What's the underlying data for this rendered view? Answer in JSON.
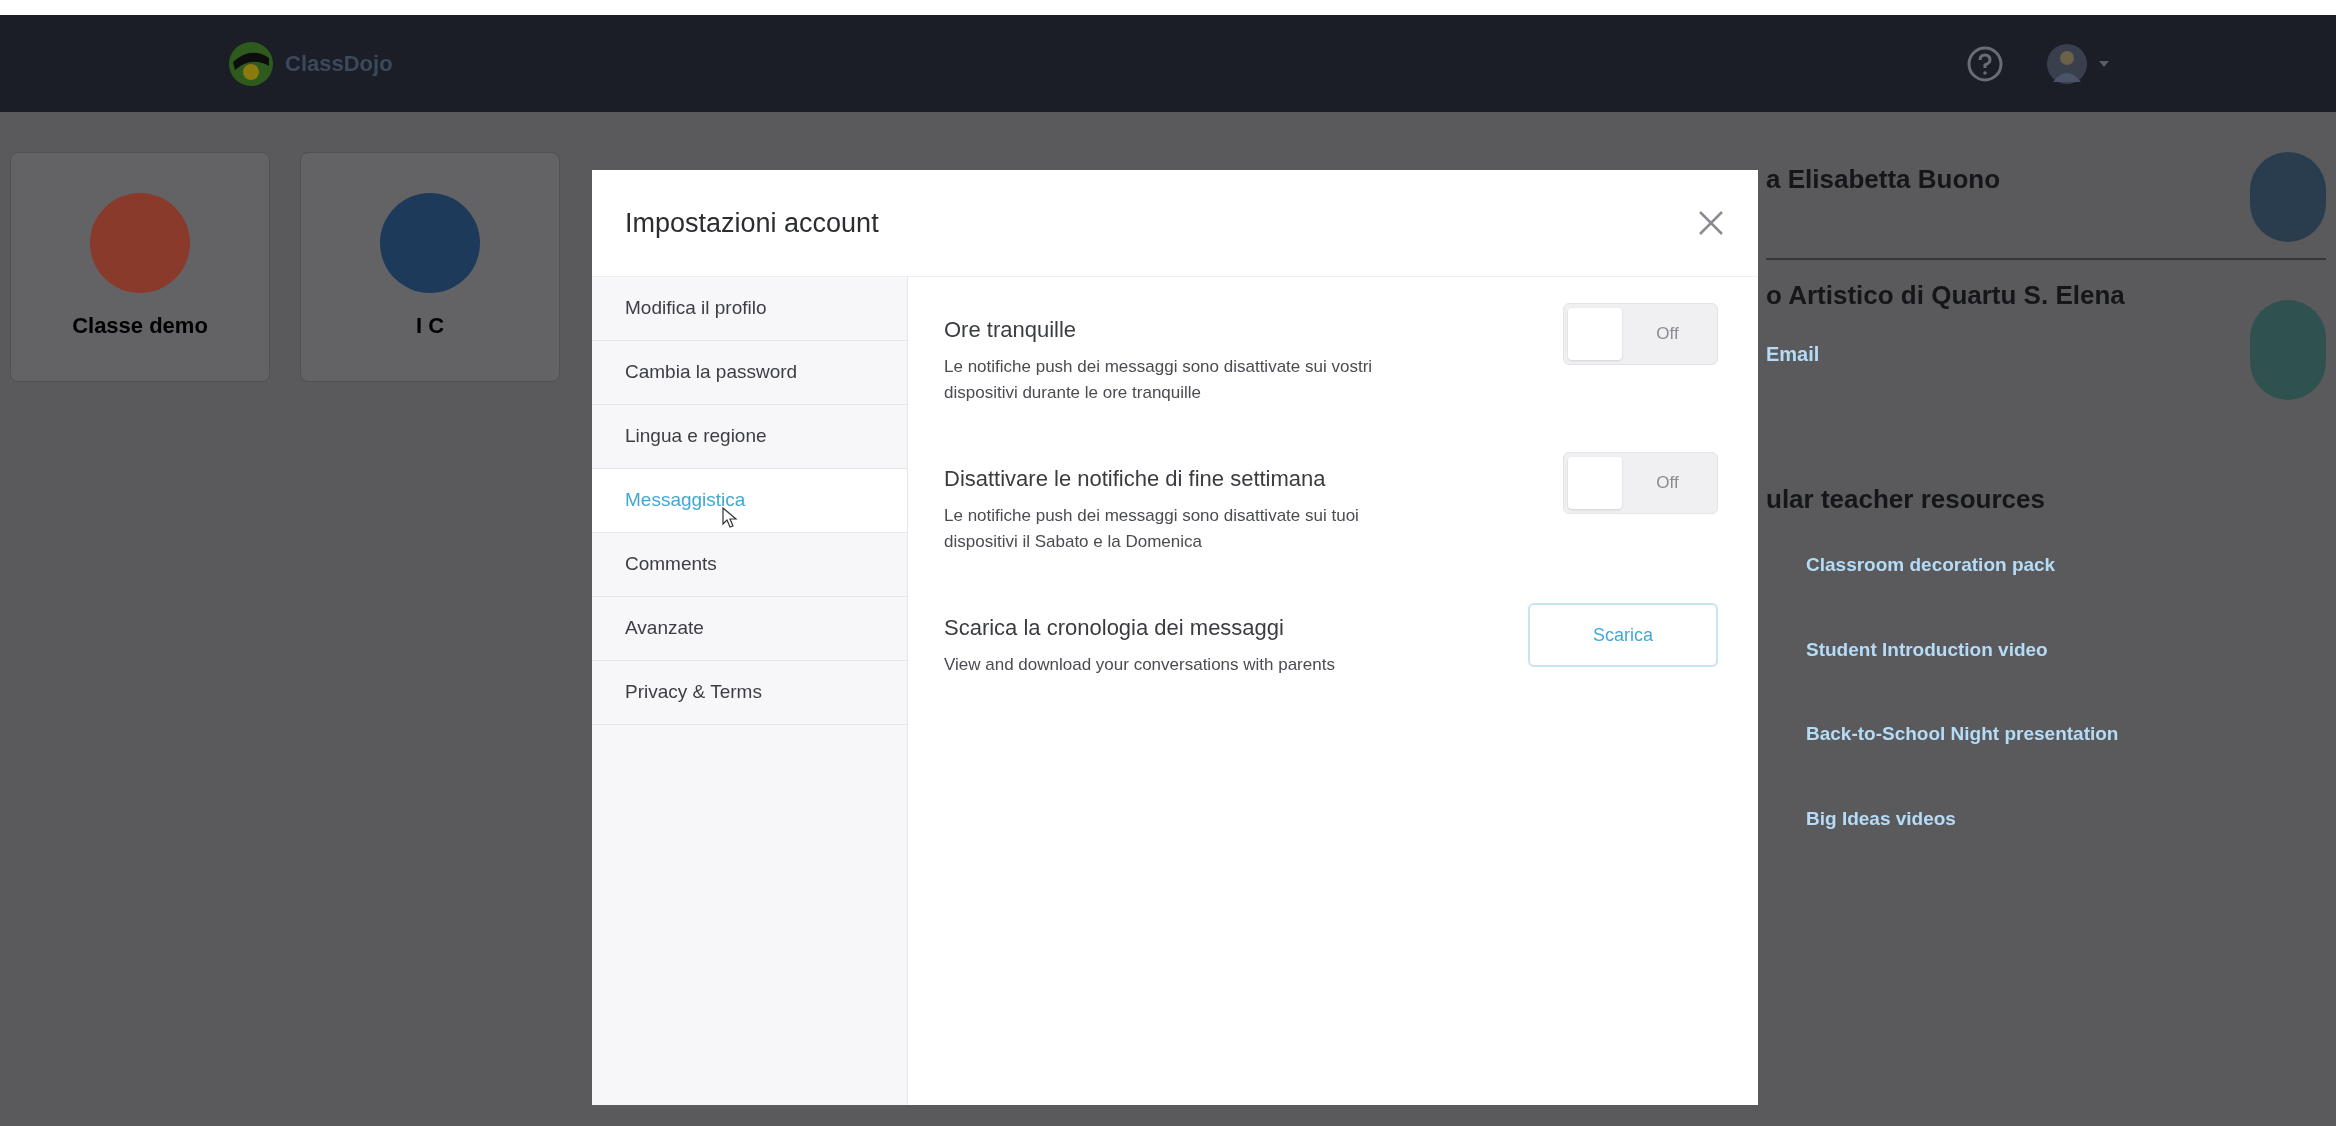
{
  "top_bar": {
    "logo_text": "ClassDojo"
  },
  "classes": [
    {
      "name": "Classe demo",
      "color": "#8a3a2a"
    },
    {
      "name": "I C",
      "color": "#1d3a5a"
    }
  ],
  "profile": {
    "name": "a Elisabetta Buono"
  },
  "school": {
    "name": "o Artistico di Quartu S. Elena",
    "link": "Email"
  },
  "resources": {
    "heading": "ular teacher resources",
    "items": [
      "Classroom decoration pack",
      "Student Introduction video",
      "Back-to-School Night presentation",
      "Big Ideas videos"
    ]
  },
  "modal": {
    "title": "Impostazioni account",
    "sidebar": [
      {
        "label": "Modifica il profilo",
        "selected": false
      },
      {
        "label": "Cambia la password",
        "selected": false
      },
      {
        "label": "Lingua e regione",
        "selected": false
      },
      {
        "label": "Messaggistica",
        "selected": true
      },
      {
        "label": "Comments",
        "selected": false
      },
      {
        "label": "Avanzate",
        "selected": false
      },
      {
        "label": "Privacy & Terms",
        "selected": false
      }
    ],
    "settings": [
      {
        "kind": "toggle",
        "title": "Ore tranquille",
        "description": "Le notifiche push dei messaggi sono disattivate sui vostri dispositivi durante le ore tranquille",
        "on": false,
        "state_label": "Off"
      },
      {
        "kind": "toggle",
        "title": "Disattivare le notifiche di fine settimana",
        "description": "Le notifiche push dei messaggi sono disattivate sui tuoi dispositivi il Sabato e la Domenica",
        "on": false,
        "state_label": "Off"
      },
      {
        "kind": "button",
        "title": "Scarica la cronologia dei messaggi",
        "description": "View and download your conversations with parents",
        "button": "Scarica"
      }
    ]
  }
}
